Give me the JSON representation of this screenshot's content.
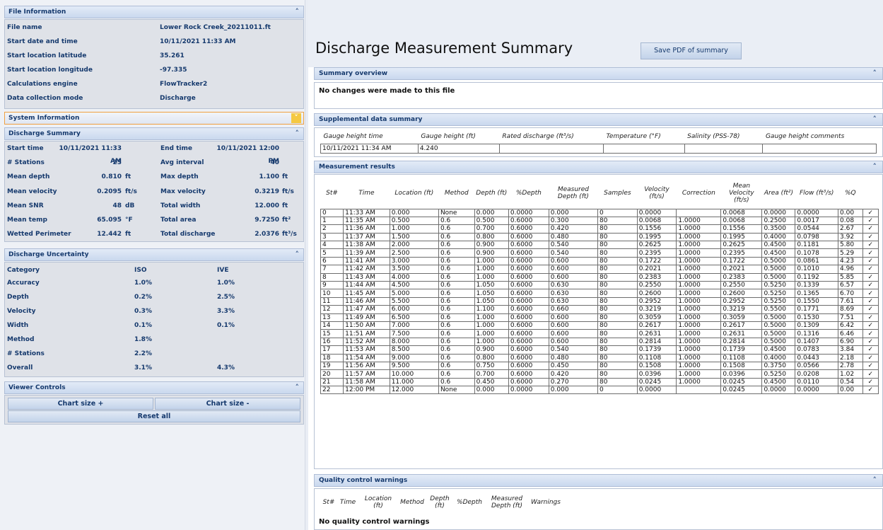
{
  "file_info": {
    "title": "File Information",
    "rows": [
      {
        "label": "File name",
        "value": "Lower Rock Creek_20211011.ft"
      },
      {
        "label": "Start date and time",
        "value": "10/11/2021 11:33 AM"
      },
      {
        "label": "Start location latitude",
        "value": "35.261"
      },
      {
        "label": "Start location longitude",
        "value": "-97.335"
      },
      {
        "label": "Calculations engine",
        "value": "FlowTracker2"
      },
      {
        "label": "Data collection mode",
        "value": "Discharge"
      }
    ]
  },
  "system_info": {
    "title": "System Information"
  },
  "discharge_summary": {
    "title": "Discharge Summary",
    "rows": [
      {
        "l1": "Start time",
        "v1": "10/11/2021 11:33 AM",
        "u1": "",
        "l2": "End time",
        "v2": "10/11/2021 12:00 PM",
        "u2": ""
      },
      {
        "l1": "# Stations",
        "v1": "23",
        "u1": "",
        "l2": "Avg interval",
        "v2": "40",
        "u2": ""
      },
      {
        "l1": "Mean depth",
        "v1": "0.810",
        "u1": "ft",
        "l2": "Max depth",
        "v2": "1.100",
        "u2": "ft"
      },
      {
        "l1": "Mean velocity",
        "v1": "0.2095",
        "u1": "ft/s",
        "l2": "Max velocity",
        "v2": "0.3219",
        "u2": "ft/s"
      },
      {
        "l1": "Mean SNR",
        "v1": "48",
        "u1": "dB",
        "l2": "Total width",
        "v2": "12.000",
        "u2": "ft"
      },
      {
        "l1": "Mean temp",
        "v1": "65.095",
        "u1": "°F",
        "l2": "Total area",
        "v2": "9.7250",
        "u2": "ft²"
      },
      {
        "l1": "Wetted Perimeter",
        "v1": "12.442",
        "u1": "ft",
        "l2": "Total discharge",
        "v2": "2.0376",
        "u2": "ft³/s"
      }
    ]
  },
  "uncertainty": {
    "title": "Discharge Uncertainty",
    "header": {
      "category": "Category",
      "iso": "ISO",
      "ive": "IVE"
    },
    "rows": [
      {
        "category": "Accuracy",
        "iso": "1.0%",
        "ive": "1.0%"
      },
      {
        "category": "Depth",
        "iso": "0.2%",
        "ive": "2.5%"
      },
      {
        "category": "Velocity",
        "iso": "0.3%",
        "ive": "3.3%"
      },
      {
        "category": "Width",
        "iso": "0.1%",
        "ive": "0.1%"
      },
      {
        "category": "Method",
        "iso": "1.8%",
        "ive": ""
      },
      {
        "category": "# Stations",
        "iso": "2.2%",
        "ive": ""
      },
      {
        "category": "Overall",
        "iso": "3.1%",
        "ive": "4.3%"
      }
    ]
  },
  "viewer_controls": {
    "title": "Viewer Controls",
    "chart_size_plus": "Chart size +",
    "chart_size_minus": "Chart size -",
    "reset_all": "Reset all"
  },
  "main": {
    "title": "Discharge Measurement Summary",
    "save_pdf": "Save PDF of summary"
  },
  "summary_overview": {
    "title": "Summary overview",
    "text": "No changes were made to this file"
  },
  "supplemental": {
    "title": "Supplemental data summary",
    "headers": [
      "Gauge height time",
      "Gauge height (ft)",
      "Rated discharge (ft³/s)",
      "Temperature (°F)",
      "Salinity (PSS-78)",
      "Gauge height comments"
    ],
    "row": [
      "10/11/2021 11:34 AM",
      "4.240",
      "",
      "",
      "",
      ""
    ]
  },
  "measurement_results": {
    "title": "Measurement results",
    "headers": [
      "St#",
      "Time",
      "Location (ft)",
      "Method",
      "Depth (ft)",
      "%Depth",
      "Measured Depth (ft)",
      "Samples",
      "Velocity (ft/s)",
      "Correction",
      "Mean Velocity (ft/s)",
      "Area (ft²)",
      "Flow (ft³/s)",
      "%Q"
    ],
    "rows": [
      [
        "0",
        "11:33 AM",
        "0.000",
        "None",
        "0.000",
        "0.0000",
        "0.000",
        "0",
        "0.0000",
        "",
        "0.0068",
        "0.0000",
        "0.0000",
        "0.00"
      ],
      [
        "1",
        "11:35 AM",
        "0.500",
        "0.6",
        "0.500",
        "0.6000",
        "0.300",
        "80",
        "0.0068",
        "1.0000",
        "0.0068",
        "0.2500",
        "0.0017",
        "0.08"
      ],
      [
        "2",
        "11:36 AM",
        "1.000",
        "0.6",
        "0.700",
        "0.6000",
        "0.420",
        "80",
        "0.1556",
        "1.0000",
        "0.1556",
        "0.3500",
        "0.0544",
        "2.67"
      ],
      [
        "3",
        "11:37 AM",
        "1.500",
        "0.6",
        "0.800",
        "0.6000",
        "0.480",
        "80",
        "0.1995",
        "1.0000",
        "0.1995",
        "0.4000",
        "0.0798",
        "3.92"
      ],
      [
        "4",
        "11:38 AM",
        "2.000",
        "0.6",
        "0.900",
        "0.6000",
        "0.540",
        "80",
        "0.2625",
        "1.0000",
        "0.2625",
        "0.4500",
        "0.1181",
        "5.80"
      ],
      [
        "5",
        "11:39 AM",
        "2.500",
        "0.6",
        "0.900",
        "0.6000",
        "0.540",
        "80",
        "0.2395",
        "1.0000",
        "0.2395",
        "0.4500",
        "0.1078",
        "5.29"
      ],
      [
        "6",
        "11:41 AM",
        "3.000",
        "0.6",
        "1.000",
        "0.6000",
        "0.600",
        "80",
        "0.1722",
        "1.0000",
        "0.1722",
        "0.5000",
        "0.0861",
        "4.23"
      ],
      [
        "7",
        "11:42 AM",
        "3.500",
        "0.6",
        "1.000",
        "0.6000",
        "0.600",
        "80",
        "0.2021",
        "1.0000",
        "0.2021",
        "0.5000",
        "0.1010",
        "4.96"
      ],
      [
        "8",
        "11:43 AM",
        "4.000",
        "0.6",
        "1.000",
        "0.6000",
        "0.600",
        "80",
        "0.2383",
        "1.0000",
        "0.2383",
        "0.5000",
        "0.1192",
        "5.85"
      ],
      [
        "9",
        "11:44 AM",
        "4.500",
        "0.6",
        "1.050",
        "0.6000",
        "0.630",
        "80",
        "0.2550",
        "1.0000",
        "0.2550",
        "0.5250",
        "0.1339",
        "6.57"
      ],
      [
        "10",
        "11:45 AM",
        "5.000",
        "0.6",
        "1.050",
        "0.6000",
        "0.630",
        "80",
        "0.2600",
        "1.0000",
        "0.2600",
        "0.5250",
        "0.1365",
        "6.70"
      ],
      [
        "11",
        "11:46 AM",
        "5.500",
        "0.6",
        "1.050",
        "0.6000",
        "0.630",
        "80",
        "0.2952",
        "1.0000",
        "0.2952",
        "0.5250",
        "0.1550",
        "7.61"
      ],
      [
        "12",
        "11:47 AM",
        "6.000",
        "0.6",
        "1.100",
        "0.6000",
        "0.660",
        "80",
        "0.3219",
        "1.0000",
        "0.3219",
        "0.5500",
        "0.1771",
        "8.69"
      ],
      [
        "13",
        "11:49 AM",
        "6.500",
        "0.6",
        "1.000",
        "0.6000",
        "0.600",
        "80",
        "0.3059",
        "1.0000",
        "0.3059",
        "0.5000",
        "0.1530",
        "7.51"
      ],
      [
        "14",
        "11:50 AM",
        "7.000",
        "0.6",
        "1.000",
        "0.6000",
        "0.600",
        "80",
        "0.2617",
        "1.0000",
        "0.2617",
        "0.5000",
        "0.1309",
        "6.42"
      ],
      [
        "15",
        "11:51 AM",
        "7.500",
        "0.6",
        "1.000",
        "0.6000",
        "0.600",
        "80",
        "0.2631",
        "1.0000",
        "0.2631",
        "0.5000",
        "0.1316",
        "6.46"
      ],
      [
        "16",
        "11:52 AM",
        "8.000",
        "0.6",
        "1.000",
        "0.6000",
        "0.600",
        "80",
        "0.2814",
        "1.0000",
        "0.2814",
        "0.5000",
        "0.1407",
        "6.90"
      ],
      [
        "17",
        "11:53 AM",
        "8.500",
        "0.6",
        "0.900",
        "0.6000",
        "0.540",
        "80",
        "0.1739",
        "1.0000",
        "0.1739",
        "0.4500",
        "0.0783",
        "3.84"
      ],
      [
        "18",
        "11:54 AM",
        "9.000",
        "0.6",
        "0.800",
        "0.6000",
        "0.480",
        "80",
        "0.1108",
        "1.0000",
        "0.1108",
        "0.4000",
        "0.0443",
        "2.18"
      ],
      [
        "19",
        "11:56 AM",
        "9.500",
        "0.6",
        "0.750",
        "0.6000",
        "0.450",
        "80",
        "0.1508",
        "1.0000",
        "0.1508",
        "0.3750",
        "0.0566",
        "2.78"
      ],
      [
        "20",
        "11:57 AM",
        "10.000",
        "0.6",
        "0.700",
        "0.6000",
        "0.420",
        "80",
        "0.0396",
        "1.0000",
        "0.0396",
        "0.5250",
        "0.0208",
        "1.02"
      ],
      [
        "21",
        "11:58 AM",
        "11.000",
        "0.6",
        "0.450",
        "0.6000",
        "0.270",
        "80",
        "0.0245",
        "1.0000",
        "0.0245",
        "0.4500",
        "0.0110",
        "0.54"
      ],
      [
        "22",
        "12:00 PM",
        "12.000",
        "None",
        "0.000",
        "0.0000",
        "0.000",
        "0",
        "0.0000",
        "",
        "0.0245",
        "0.0000",
        "0.0000",
        "0.00"
      ]
    ]
  },
  "quality_control": {
    "title": "Quality control warnings",
    "headers": [
      "St#",
      "Time",
      "Location (ft)",
      "Method",
      "Depth (ft)",
      "%Depth",
      "Measured Depth (ft)",
      "Warnings"
    ],
    "text": "No quality control warnings"
  },
  "icons": {
    "collapse": "chevron-up-icon",
    "expand": "chevron-down-icon",
    "check": "check-icon"
  },
  "colors": {
    "panel_text": "#15396d",
    "check": "#2a9b2a",
    "highlight": "#f5c842"
  }
}
